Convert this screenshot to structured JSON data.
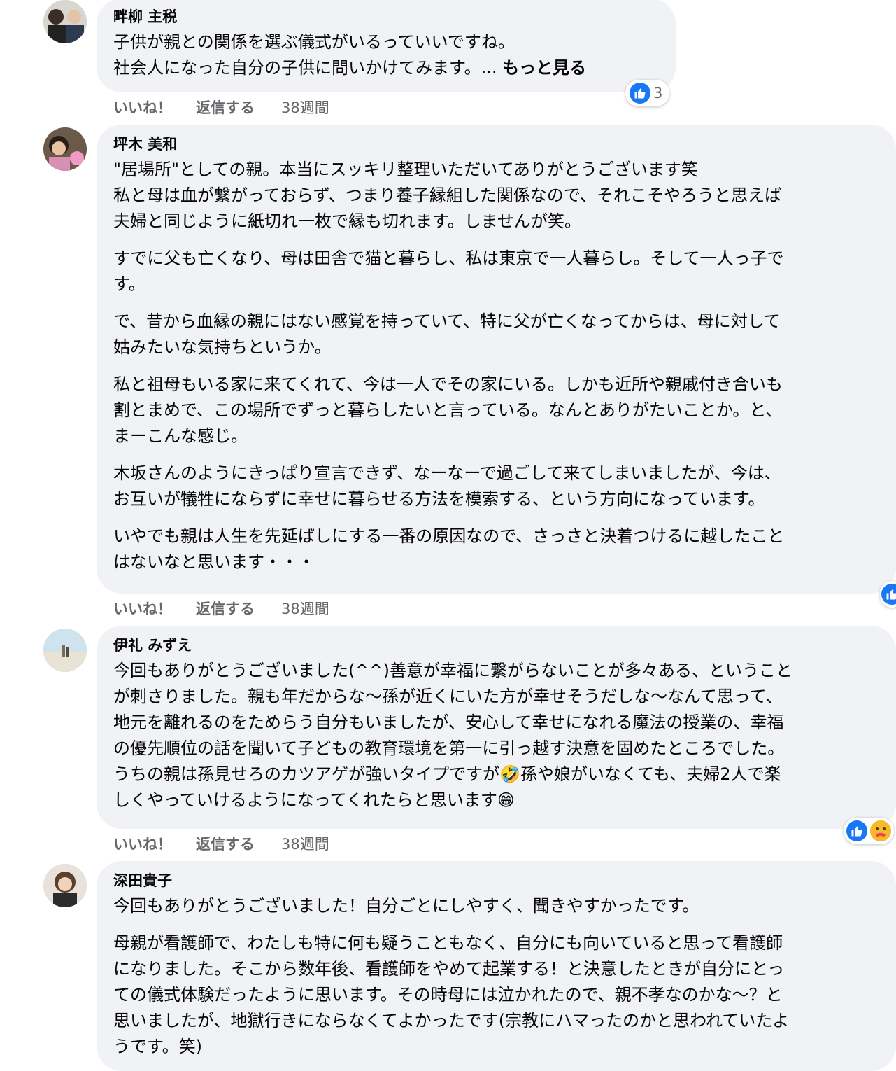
{
  "comments": [
    {
      "author": "畔柳 主税",
      "paragraphs": [
        "子供が親との関係を選ぶ儀式がいるっていいですね。",
        "社会人になった自分の子供に問いかけてみます。..."
      ],
      "see_more": "もっと見る",
      "like": "いいね！",
      "reply": "返信する",
      "time": "38週間",
      "reaction_count": "3"
    },
    {
      "author": "坪木 美和",
      "paragraphs": [
        "\"居場所\"としての親。本当にスッキリ整理いただいてありがとうございます笑",
        "私と母は血が繋がっておらず、つまり養子縁組した関係なので、それこそやろうと思えば",
        "夫婦と同じように紙切れ一枚で縁も切れます。しませんが笑。",
        "すでに父も亡くなり、母は田舎で猫と暮らし、私は東京で一人暮らし。そして一人っ子で",
        "す。",
        "で、昔から血縁の親にはない感覚を持っていて、特に父が亡くなってからは、母に対して",
        "姑みたいな気持ちというか。",
        "私と祖母もいる家に来てくれて、今は一人でその家にいる。しかも近所や親戚付き合いも",
        "割とまめで、この場所でずっと暮らしたいと言っている。なんとありがたいことか。と、",
        "まーこんな感じ。",
        "木坂さんのようにきっぱり宣言できず、なーなーで過ごして来てしまいましたが、今は、",
        "お互いが犠牲にならずに幸せに暮らせる方法を模索する、という方向になっています。",
        "いやでも親は人生を先延ばしにする一番の原因なので、さっさと決着つけるに越したこと",
        "はないなと思います・・・"
      ],
      "like": "いいね！",
      "reply": "返信する",
      "time": "38週間"
    },
    {
      "author": "伊礼 みずえ",
      "paragraphs": [
        "今回もありがとうございました(^^)善意が幸福に繋がらないことが多々ある、ということ",
        "が刺さりました。親も年だからな〜孫が近くにいた方が幸せそうだしな〜なんて思って、",
        "地元を離れるのをためらう自分もいましたが、安心して幸せになれる魔法の授業の、幸福",
        "の優先順位の話を聞いて子どもの教育環境を第一に引っ越す決意を固めたところでした。",
        "うちの親は孫見せろのカツアゲが強いタイプですが",
        "孫や娘がいなくても、夫婦2人で楽",
        "しくやっていけるようになってくれたらと思います"
      ],
      "emoji_laugh": "🤣",
      "emoji_grin": "😁",
      "like": "いいね！",
      "reply": "返信する",
      "time": "38週間"
    },
    {
      "author": "深田貴子",
      "paragraphs": [
        "今回もありがとうございました！自分ごとにしやすく、聞きやすかったです。",
        "母親が看護師で、わたしも特に何も疑うこともなく、自分にも向いていると思って看護師",
        "になりました。そこから数年後、看護師をやめて起業する！と決意したときが自分にとっ",
        "ての儀式体験だったように思います。その時母には泣かれたので、親不孝なのかな〜？と",
        "思いましたが、地獄行きにならなくてよかったです(宗教にハマったのかと思われていたよ",
        "うです。笑)"
      ]
    }
  ],
  "icons": {
    "like_reaction": "like-icon",
    "care_reaction": "care-icon"
  },
  "colors": {
    "bubble": "#f0f2f5",
    "meta": "#65676b",
    "like_blue": "#1877f2"
  }
}
